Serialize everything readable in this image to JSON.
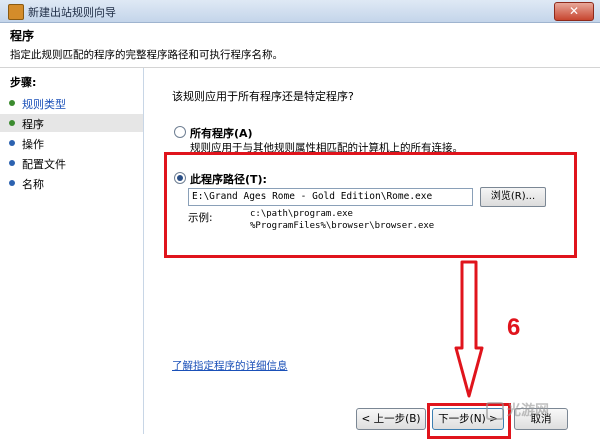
{
  "window": {
    "title": "新建出站规则向导",
    "close_label": "✕"
  },
  "header": {
    "title": "程序",
    "description": "指定此规则匹配的程序的完整程序路径和可执行程序名称。"
  },
  "sidebar": {
    "title": "步骤:",
    "items": [
      {
        "label": "规则类型"
      },
      {
        "label": "程序"
      },
      {
        "label": "操作"
      },
      {
        "label": "配置文件"
      },
      {
        "label": "名称"
      }
    ]
  },
  "main": {
    "question": "该规则应用于所有程序还是特定程序?",
    "all_programs": {
      "label": "所有程序(A)",
      "description": "规则应用于与其他规则属性相匹配的计算机上的所有连接。",
      "selected": false
    },
    "this_program": {
      "label": "此程序路径(T):",
      "selected": true
    },
    "path_value": "E:\\Grand Ages Rome - Gold Edition\\Rome.exe",
    "browse_label": "浏览(R)...",
    "example_label": "示例:",
    "example_1": "c:\\path\\program.exe",
    "example_2": "%ProgramFiles%\\browser\\browser.exe",
    "learn_more": "了解指定程序的详细信息"
  },
  "footer": {
    "back_label": "< 上一步(B)",
    "next_label": "下一步(N) >",
    "cancel_label": "取消"
  },
  "annotation": {
    "step_number": "6"
  },
  "watermark": {
    "text": "光游网"
  },
  "colors": {
    "highlight_red": "#e0141c",
    "link_blue": "#1a50b8"
  }
}
